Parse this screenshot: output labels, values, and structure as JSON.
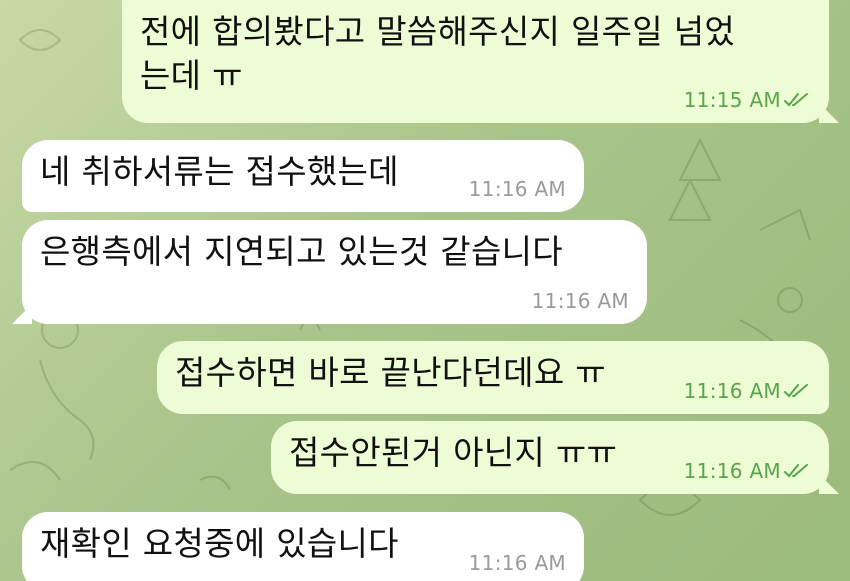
{
  "messages": [
    {
      "direction": "outgoing",
      "lines": [
        "전에 합의봤다고 말씀해주신지 일주일 넘었",
        "는데 ㅠ"
      ],
      "time": "11:15 AM",
      "status": "read"
    },
    {
      "direction": "incoming",
      "lines": [
        "네 취하서류는 접수했는데"
      ],
      "time": "11:16 AM"
    },
    {
      "direction": "incoming",
      "lines": [
        "은행측에서 지연되고 있는것 같습니다"
      ],
      "time": "11:16 AM"
    },
    {
      "direction": "outgoing",
      "lines": [
        "접수하면 바로 끝난다던데요 ㅠ"
      ],
      "time": "11:16 AM",
      "status": "read"
    },
    {
      "direction": "outgoing",
      "lines": [
        "접수안된거 아닌지 ㅠㅠ"
      ],
      "time": "11:16 AM",
      "status": "read"
    },
    {
      "direction": "incoming",
      "lines": [
        "재확인 요청중에 있습니다"
      ],
      "time": "11:16 AM"
    }
  ],
  "icons": {
    "read_status": "double-check-icon"
  },
  "colors": {
    "outgoing_bubble": "#eefcd6",
    "incoming_bubble": "#ffffff",
    "outgoing_time": "#5aa44a",
    "incoming_time": "#9a9a9a",
    "background": "#a9c48a"
  }
}
